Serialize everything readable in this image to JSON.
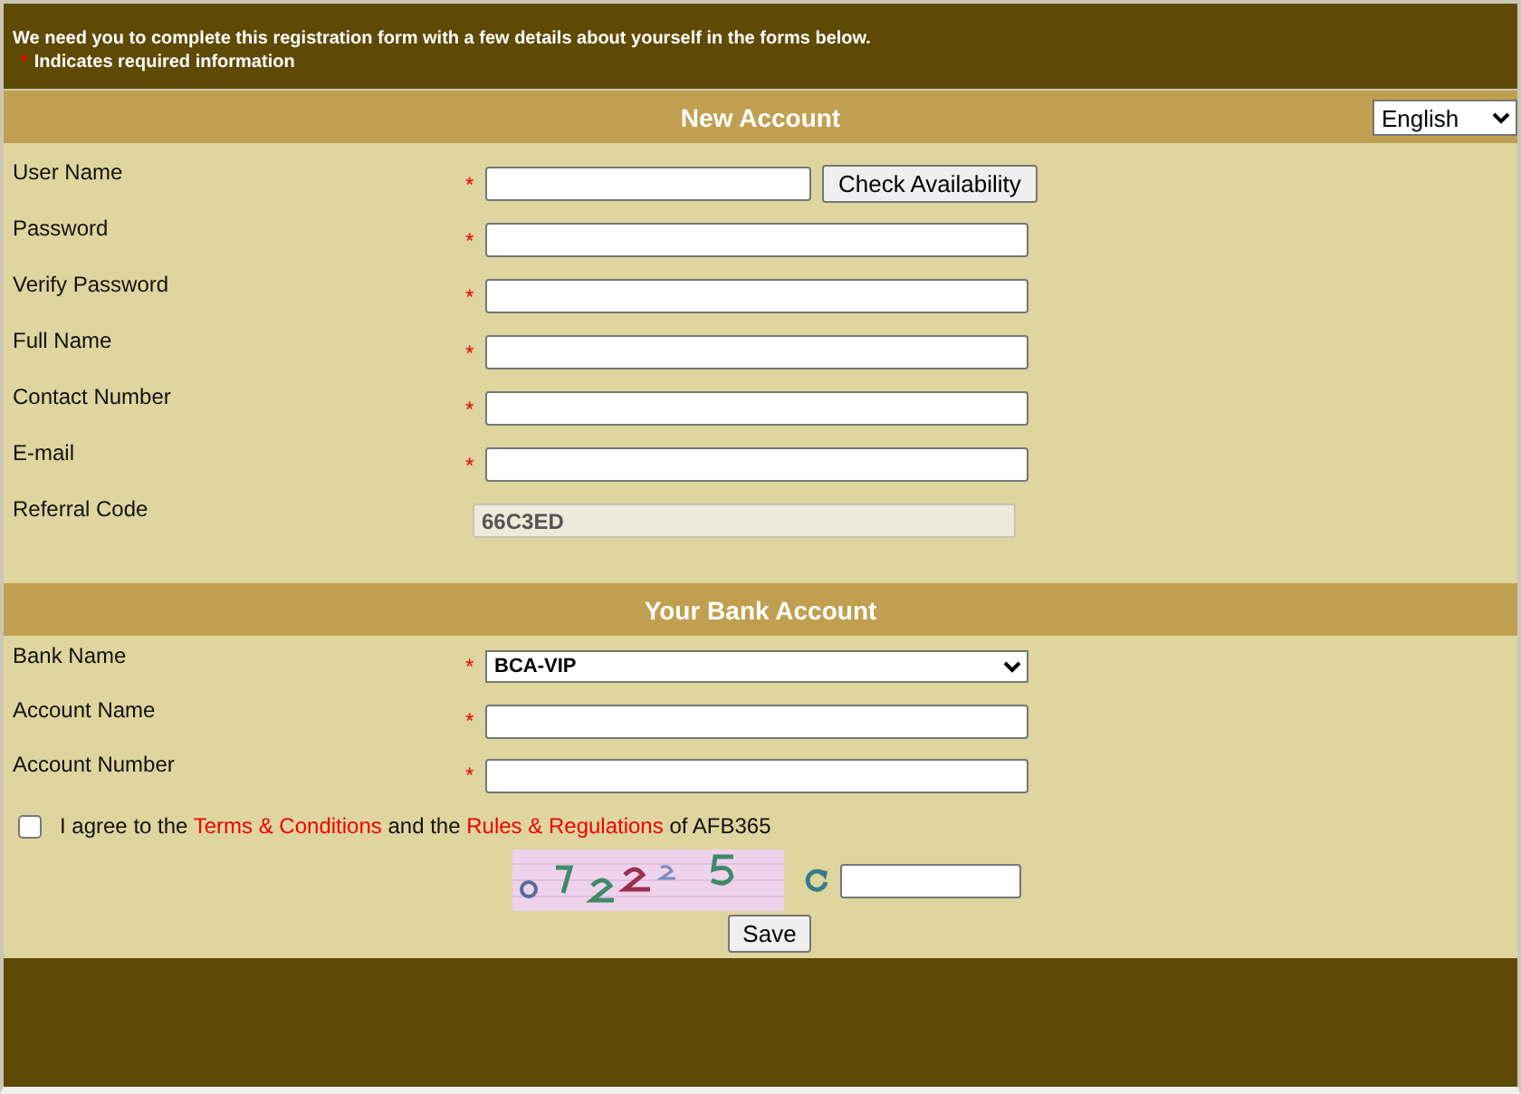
{
  "header": {
    "intro": "We need you to complete this registration form with a few details about yourself in the forms below.",
    "required_mark": "*",
    "required_note": "Indicates required information"
  },
  "new_account": {
    "title": "New Account",
    "language": "English",
    "check_button": "Check Availability",
    "fields": [
      {
        "label": "User Name",
        "required_mark": "*",
        "kind": "username"
      },
      {
        "label": "Password",
        "required_mark": "*",
        "kind": "text"
      },
      {
        "label": "Verify Password",
        "required_mark": "*",
        "kind": "text"
      },
      {
        "label": "Full Name",
        "required_mark": "*",
        "kind": "text"
      },
      {
        "label": "Contact Number",
        "required_mark": "*",
        "kind": "text"
      },
      {
        "label": "E-mail",
        "required_mark": "*",
        "kind": "text"
      },
      {
        "label": "Referral Code",
        "kind": "text",
        "value": "66C3ED",
        "disabled": true
      }
    ]
  },
  "bank_account": {
    "title": "Your Bank Account",
    "fields": [
      {
        "label": "Bank Name",
        "required_mark": "*",
        "kind": "select",
        "value": "BCA-VIP"
      },
      {
        "label": "Account Name",
        "required_mark": "*",
        "kind": "text"
      },
      {
        "label": "Account Number",
        "required_mark": "*",
        "kind": "text"
      }
    ]
  },
  "agreement": {
    "checked": false,
    "parts": [
      {
        "kind": "text",
        "text": "I agree to the"
      },
      {
        "kind": "link",
        "text": "Terms & Conditions"
      },
      {
        "kind": "text",
        "text": "and the"
      },
      {
        "kind": "link",
        "text": "Rules & Regulations"
      },
      {
        "kind": "text",
        "text": "of AFB365"
      }
    ]
  },
  "save_button": "Save"
}
